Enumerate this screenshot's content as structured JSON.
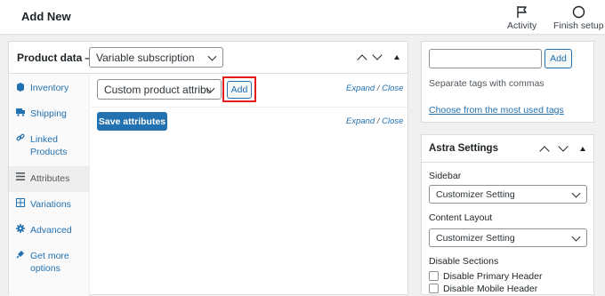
{
  "topbar": {
    "title": "Add New",
    "activity_label": "Activity",
    "finish_setup_label": "Finish setup"
  },
  "product_data": {
    "title": "Product data —",
    "type_select": "Variable subscription",
    "tabs": [
      {
        "label": "Inventory",
        "icon": "inventory-icon"
      },
      {
        "label": "Shipping",
        "icon": "shipping-truck-icon"
      },
      {
        "label": "Linked Products",
        "icon": "link-icon"
      },
      {
        "label": "Attributes",
        "icon": "list-icon"
      },
      {
        "label": "Variations",
        "icon": "grid-icon"
      },
      {
        "label": "Advanced",
        "icon": "gear-icon"
      },
      {
        "label": "Get more options",
        "icon": "plug-icon"
      }
    ],
    "attribute_select": "Custom product attribute",
    "add_label": "Add",
    "expand_label": "Expand",
    "separator": "/",
    "close_label": "Close",
    "save_attributes_label": "Save attributes"
  },
  "tags": {
    "add_label": "Add",
    "help": "Separate tags with commas",
    "choose_link": "Choose from the most used tags"
  },
  "astra": {
    "title": "Astra Settings",
    "sidebar_label": "Sidebar",
    "sidebar_value": "Customizer Setting",
    "content_layout_label": "Content Layout",
    "content_layout_value": "Customizer Setting",
    "disable_sections_label": "Disable Sections",
    "disable_primary_header": "Disable Primary Header",
    "disable_mobile_header": "Disable Mobile Header"
  },
  "colors": {
    "accent": "#2271b1",
    "highlight": "#e21d1d"
  }
}
